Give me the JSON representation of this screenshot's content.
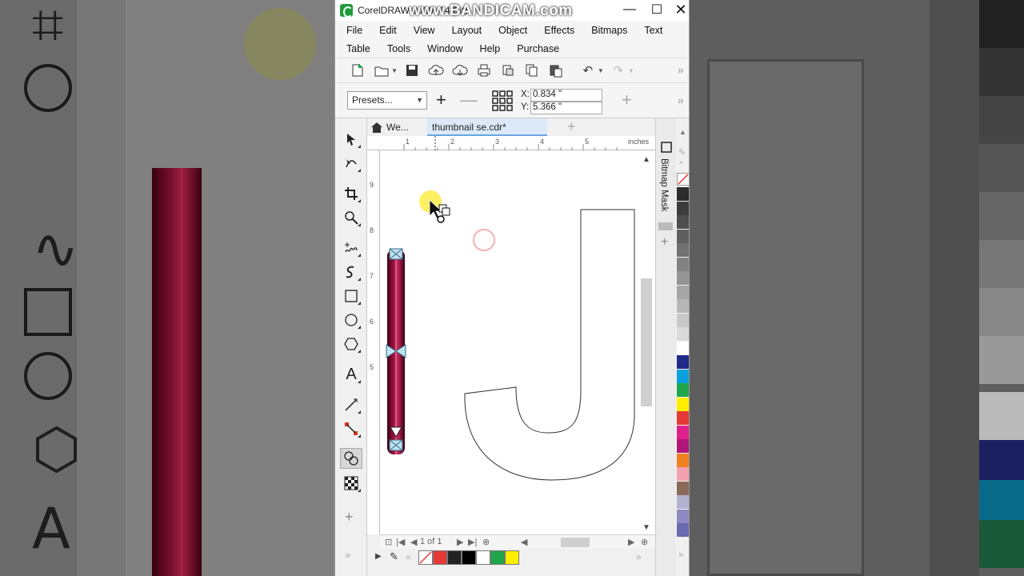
{
  "window": {
    "title": "CorelDRAW 2020 (64-Bit)",
    "watermark": "www.BANDICAM.com",
    "minimize": "—",
    "maximize": "☐",
    "close": "✕"
  },
  "menu": {
    "row1": [
      "File",
      "Edit",
      "View",
      "Layout",
      "Object",
      "Effects",
      "Bitmaps",
      "Text"
    ],
    "row2": [
      "Table",
      "Tools",
      "Window",
      "Help",
      "Purchase"
    ]
  },
  "toolbar": {
    "icons": [
      "new-document-icon",
      "open-icon",
      "save-icon",
      "upload-cloud-icon",
      "download-cloud-icon",
      "print-icon",
      "cut-icon",
      "copy-icon",
      "paste-icon",
      "undo-icon",
      "redo-icon"
    ],
    "more": "»"
  },
  "propbar": {
    "presets_label": "Presets...",
    "add": "+",
    "remove": "—",
    "x_label": "X:",
    "x_value": "0.834 \"",
    "y_label": "Y:",
    "y_value": "5.366 \"",
    "add_right": "+",
    "more": "»"
  },
  "tabs": {
    "welcome": "We...",
    "document": "thumbnail se.cdr*",
    "add": "+",
    "close": "✕"
  },
  "ruler": {
    "units": "inches",
    "h_ticks": [
      "1",
      "2",
      "3",
      "4",
      "5"
    ],
    "v_ticks": [
      "9",
      "8",
      "7",
      "6",
      "5"
    ]
  },
  "navigator": {
    "page_of": "1   of   1"
  },
  "docker": {
    "label": "Bitmap Mask",
    "add": "+"
  },
  "colors": {
    "accent": "#6aa6e0",
    "gradient_dark": "#3b0012",
    "gradient_mid": "#b0154a",
    "highlight": "#ffeb3b",
    "palette_bottom": [
      "#e53935",
      "#222222",
      "#000000",
      "#ffffff",
      "#1fa64a",
      "#ffee00"
    ],
    "palette_side": [
      "#2b2b2b",
      "#3c3c3c",
      "#4e4e4e",
      "#5f5f5f",
      "#717171",
      "#828282",
      "#949494",
      "#a5a5a5",
      "#b7b7b7",
      "#c8c8c8",
      "#dadada",
      "#ffffff",
      "#1f2a8a",
      "#0aa0e0",
      "#1fa64a",
      "#ffee00",
      "#e53935",
      "#e0208a",
      "#b0157a",
      "#f08020",
      "#f4a0b0",
      "#8a6a5a",
      "#b4b0d0",
      "#9088c0",
      "#6a6ab0"
    ]
  }
}
